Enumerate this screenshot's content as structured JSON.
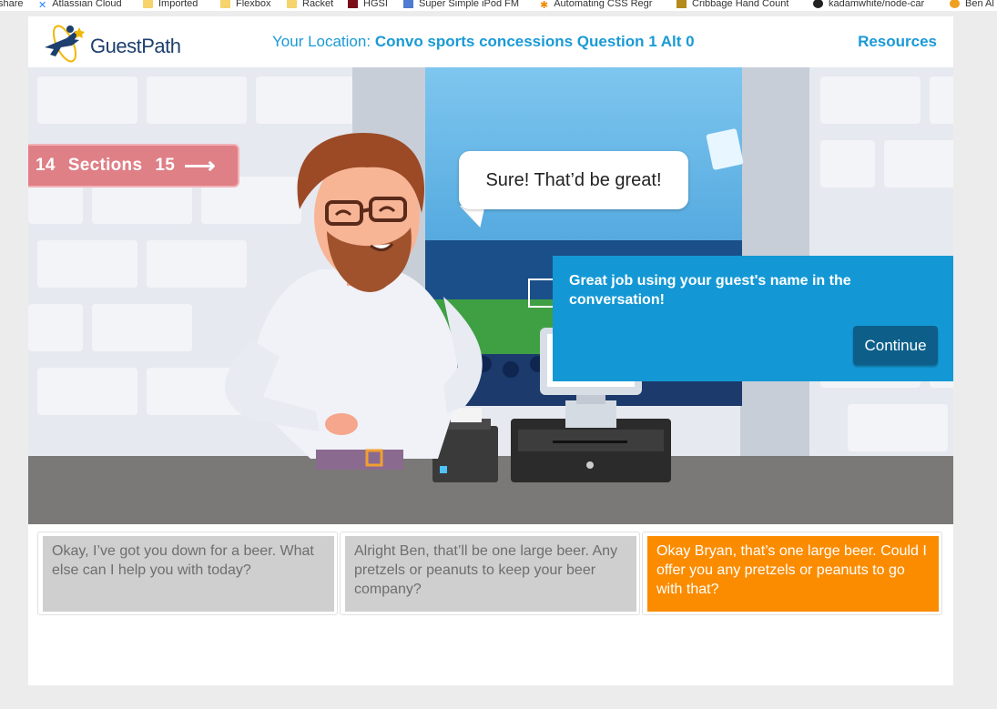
{
  "bookmarks": [
    {
      "label": "share",
      "icon": "share-icon"
    },
    {
      "label": "Atlassian Cloud",
      "icon": "atlassian-icon"
    },
    {
      "label": "Imported",
      "icon": "folder-icon"
    },
    {
      "label": "Flexbox",
      "icon": "folder-icon"
    },
    {
      "label": "Racket",
      "icon": "folder-icon"
    },
    {
      "label": "HGSI",
      "icon": "hgsi-icon"
    },
    {
      "label": "Super Simple iPod FM",
      "icon": "m-icon"
    },
    {
      "label": "Automating CSS Regr",
      "icon": "asterisk-icon"
    },
    {
      "label": "Cribbage Hand Count",
      "icon": "cribbage-icon"
    },
    {
      "label": "kadamwhite/node-car",
      "icon": "github-icon"
    },
    {
      "label": "Ben Al",
      "icon": "orange-icon"
    }
  ],
  "header": {
    "logo_text": "GuestPath",
    "location_label": "Your Location:",
    "location_value": "Convo sports concessions Question 1 Alt 0",
    "resources_label": "Resources"
  },
  "sections": {
    "prev": "14",
    "label": "Sections",
    "next": "15",
    "arrow": "⟶"
  },
  "speech_bubble": "Sure! That’d be great!",
  "feedback": {
    "message": "Great job using your guest's name in the conversation!",
    "continue_label": "Continue"
  },
  "answers": [
    {
      "text": "Okay, I’ve got you down for a beer. What else can I help you with today?",
      "selected": false
    },
    {
      "text": "Alright Ben, that’ll be one large beer. Any pretzels or peanuts to keep your beer company?",
      "selected": false
    },
    {
      "text": "Okay Bryan, that’s one large beer. Could I offer you any pretzels or peanuts to go with that?",
      "selected": true
    }
  ],
  "colors": {
    "accent": "#1a9ad6",
    "feedback_bg": "#1498d5",
    "continue_bg": "#0d5f8a",
    "sections_bg": "#df7f86",
    "selected_answer": "#fb8c00",
    "answer_bg": "#cfcfcf"
  }
}
